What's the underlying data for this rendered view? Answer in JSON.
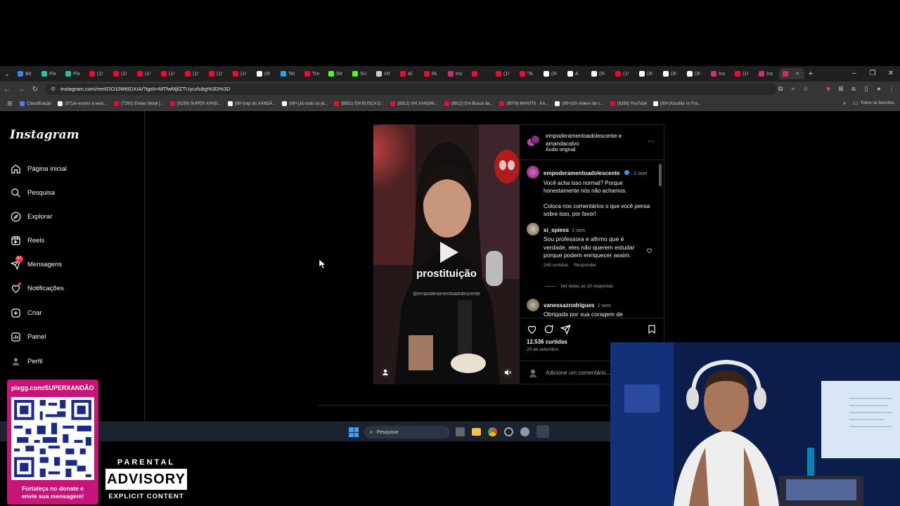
{
  "browser": {
    "tabs": [
      {
        "label": "Bit",
        "color": "#3b82f6"
      },
      {
        "label": "Pix",
        "color": "#22c1a8"
      },
      {
        "label": "Pix",
        "color": "#22c1a8"
      },
      {
        "label": "(1!",
        "color": "#ff0033"
      },
      {
        "label": "(1!",
        "color": "#ff0033"
      },
      {
        "label": "(1!",
        "color": "#ff0033"
      },
      {
        "label": "(1!",
        "color": "#ff0033"
      },
      {
        "label": "(1!",
        "color": "#ff0033"
      },
      {
        "label": "(1!",
        "color": "#ff0033"
      },
      {
        "label": "(1!",
        "color": "#ff0033"
      },
      {
        "label": "(9!",
        "color": "#ffffff"
      },
      {
        "label": "Tel",
        "color": "#2aa3df"
      },
      {
        "label": "Tre",
        "color": "#ff0033"
      },
      {
        "label": "Str",
        "color": "#53fc18"
      },
      {
        "label": "SU",
        "color": "#53fc18"
      },
      {
        "label": "VII",
        "color": "#cccccc"
      },
      {
        "label": "Al",
        "color": "#ff0033"
      },
      {
        "label": "RL",
        "color": "#ff0033"
      },
      {
        "label": "Ins",
        "color": "#d62976"
      },
      {
        "label": "",
        "color": "#ff0033"
      },
      {
        "label": "(1!",
        "color": "#ff0033"
      },
      {
        "label": "\"N",
        "color": "#ff0033"
      },
      {
        "label": "(9!",
        "color": "#ffffff"
      },
      {
        "label": "A",
        "color": "#ffffff"
      },
      {
        "label": "(9!",
        "color": "#ffffff"
      },
      {
        "label": "(1!",
        "color": "#ff0033"
      },
      {
        "label": "(9!",
        "color": "#ffffff"
      },
      {
        "label": "(9!",
        "color": "#ffffff"
      },
      {
        "label": "(9!",
        "color": "#ffffff"
      },
      {
        "label": "Ins",
        "color": "#d62976"
      },
      {
        "label": "(1!",
        "color": "#ff0033"
      },
      {
        "label": "Ins",
        "color": "#d62976"
      },
      {
        "label": "",
        "color": "#d62976"
      }
    ],
    "url": "instagram.com/reel/DO10Mt9DXIA/?igsh=MTlwMjllZTUyczlubg%3D%3D",
    "bookmarks": [
      {
        "label": "Classificação",
        "color": "#4f7cff"
      },
      {
        "label": "(97)Je ensino a venc...",
        "color": "#ffffff"
      },
      {
        "label": "(7292) Enéas Metal |...",
        "color": "#ff0033"
      },
      {
        "label": "(8159) SUPER XAND...",
        "color": "#ff0033"
      },
      {
        "label": "(99+)rap do XANDÃ...",
        "color": "#ffffff"
      },
      {
        "label": "(99+)Já cedo ou já...",
        "color": "#ffffff"
      },
      {
        "label": "(8851) EM BUSCA D...",
        "color": "#ff0033"
      },
      {
        "label": "(8912) VAI XANDIN...",
        "color": "#ff0033"
      },
      {
        "label": "(8912) Em Busca da...",
        "color": "#ff0033"
      },
      {
        "label": "(9078) MANTIS · XA...",
        "color": "#ff0033"
      },
      {
        "label": "(99+)Os vídeos de c...",
        "color": "#ffffff"
      },
      {
        "label": "(9338) YouTube",
        "color": "#ff0033"
      },
      {
        "label": "(99+)Xandão vs Fra...",
        "color": "#ffffff"
      }
    ],
    "bookmarks_folder": "Todos os favoritos"
  },
  "sidebar": {
    "logo": "Instagram",
    "items": [
      {
        "label": "Página inicial",
        "icon": "home-icon"
      },
      {
        "label": "Pesquisa",
        "icon": "search-icon"
      },
      {
        "label": "Explorar",
        "icon": "compass-icon"
      },
      {
        "label": "Reels",
        "icon": "reels-icon"
      },
      {
        "label": "Mensagens",
        "icon": "messenger-icon",
        "badge": "9+"
      },
      {
        "label": "Notificações",
        "icon": "heart-icon"
      },
      {
        "label": "Criar",
        "icon": "plus-square-icon"
      },
      {
        "label": "Painel",
        "icon": "dashboard-icon"
      },
      {
        "label": "Perfil",
        "icon": "profile-avatar-icon"
      }
    ]
  },
  "reel": {
    "overlay_word": "prostituição",
    "watermark": "@empoderamentoadolescente"
  },
  "post": {
    "header_line1": "empoderamentoadolescente e",
    "header_line2": "amandacalvo",
    "audio": "Áudio original",
    "caption_user": "empoderamentoadolescente",
    "caption_time": "2 sem",
    "caption_p1": "Você acha isso normal? Porque honestamente nós não achamos.",
    "caption_p2": "Coloca nos comentários o que você pensa sobre isso, por favor!",
    "comments": [
      {
        "user": "si_spiess",
        "time": "2 sem",
        "text": "Sou professora e afirmo que é verdade, eles não querem estudar porque podem enriquecer assim.",
        "likes": "249 curtidas",
        "reply": "Responder",
        "view_replies": "Ver todas as 10 respostas"
      },
      {
        "user": "vanessazrodrigues",
        "time": "2 sem",
        "text": "Obrigada por sua coragem de"
      }
    ],
    "likes": "12.536 curtidas",
    "date": "20 de setembro",
    "add_comment_placeholder": "Adicione um comentário..."
  },
  "taskbar": {
    "search_placeholder": "Pesquisar"
  },
  "overlay": {
    "donate_url": "pixgg.com/SUPERXANDÃO",
    "donate_line1": "Fortaleça no donate e",
    "donate_line2": "envie sua mensagem!",
    "advisory_top": "PARENTAL",
    "advisory_mid": "ADVISORY",
    "advisory_bottom": "EXPLICIT CONTENT"
  }
}
